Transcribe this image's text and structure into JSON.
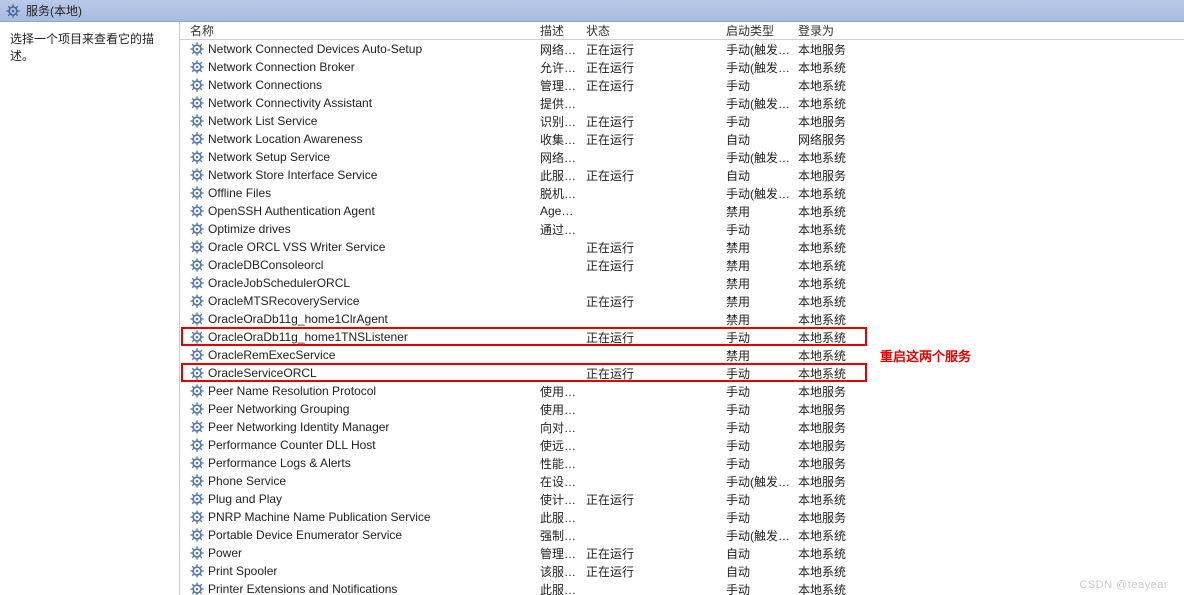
{
  "title": "服务(本地)",
  "side_hint": "选择一个项目来查看它的描述。",
  "columns": {
    "name": "名称",
    "desc": "描述",
    "status": "状态",
    "startup": "启动类型",
    "logon": "登录为"
  },
  "annotation": "重启这两个服务",
  "watermark": "CSDN @teayear",
  "rows": [
    {
      "name": "Network Connected Devices Auto-Setup",
      "desc": "网络…",
      "status": "正在运行",
      "startup": "手动(触发…",
      "logon": "本地服务"
    },
    {
      "name": "Network Connection Broker",
      "desc": "允许 …",
      "status": "正在运行",
      "startup": "手动(触发…",
      "logon": "本地系统"
    },
    {
      "name": "Network Connections",
      "desc": "管理\"…",
      "status": "正在运行",
      "startup": "手动",
      "logon": "本地系统"
    },
    {
      "name": "Network Connectivity Assistant",
      "desc": "提供 …",
      "status": "",
      "startup": "手动(触发…",
      "logon": "本地系统"
    },
    {
      "name": "Network List Service",
      "desc": "识别…",
      "status": "正在运行",
      "startup": "手动",
      "logon": "本地服务"
    },
    {
      "name": "Network Location Awareness",
      "desc": "收集…",
      "status": "正在运行",
      "startup": "自动",
      "logon": "网络服务"
    },
    {
      "name": "Network Setup Service",
      "desc": "网络…",
      "status": "",
      "startup": "手动(触发…",
      "logon": "本地系统"
    },
    {
      "name": "Network Store Interface Service",
      "desc": "此服…",
      "status": "正在运行",
      "startup": "自动",
      "logon": "本地服务"
    },
    {
      "name": "Offline Files",
      "desc": "脱机…",
      "status": "",
      "startup": "手动(触发…",
      "logon": "本地系统"
    },
    {
      "name": "OpenSSH Authentication Agent",
      "desc": "Age…",
      "status": "",
      "startup": "禁用",
      "logon": "本地系统"
    },
    {
      "name": "Optimize drives",
      "desc": "通过…",
      "status": "",
      "startup": "手动",
      "logon": "本地系统"
    },
    {
      "name": "Oracle ORCL VSS Writer Service",
      "desc": "",
      "status": "正在运行",
      "startup": "禁用",
      "logon": "本地系统"
    },
    {
      "name": "OracleDBConsoleorcl",
      "desc": "",
      "status": "正在运行",
      "startup": "禁用",
      "logon": "本地系统"
    },
    {
      "name": "OracleJobSchedulerORCL",
      "desc": "",
      "status": "",
      "startup": "禁用",
      "logon": "本地系统"
    },
    {
      "name": "OracleMTSRecoveryService",
      "desc": "",
      "status": "正在运行",
      "startup": "禁用",
      "logon": "本地系统"
    },
    {
      "name": "OracleOraDb11g_home1ClrAgent",
      "desc": "",
      "status": "",
      "startup": "禁用",
      "logon": "本地系统"
    },
    {
      "name": "OracleOraDb11g_home1TNSListener",
      "desc": "",
      "status": "正在运行",
      "startup": "手动",
      "logon": "本地系统"
    },
    {
      "name": "OracleRemExecService",
      "desc": "",
      "status": "",
      "startup": "禁用",
      "logon": "本地系统"
    },
    {
      "name": "OracleServiceORCL",
      "desc": "",
      "status": "正在运行",
      "startup": "手动",
      "logon": "本地系统"
    },
    {
      "name": "Peer Name Resolution Protocol",
      "desc": "使用…",
      "status": "",
      "startup": "手动",
      "logon": "本地服务"
    },
    {
      "name": "Peer Networking Grouping",
      "desc": "使用…",
      "status": "",
      "startup": "手动",
      "logon": "本地服务"
    },
    {
      "name": "Peer Networking Identity Manager",
      "desc": "向对…",
      "status": "",
      "startup": "手动",
      "logon": "本地服务"
    },
    {
      "name": "Performance Counter DLL Host",
      "desc": "使远…",
      "status": "",
      "startup": "手动",
      "logon": "本地服务"
    },
    {
      "name": "Performance Logs & Alerts",
      "desc": "性能…",
      "status": "",
      "startup": "手动",
      "logon": "本地服务"
    },
    {
      "name": "Phone Service",
      "desc": "在设…",
      "status": "",
      "startup": "手动(触发…",
      "logon": "本地服务"
    },
    {
      "name": "Plug and Play",
      "desc": "使计…",
      "status": "正在运行",
      "startup": "手动",
      "logon": "本地系统"
    },
    {
      "name": "PNRP Machine Name Publication Service",
      "desc": "此服…",
      "status": "",
      "startup": "手动",
      "logon": "本地服务"
    },
    {
      "name": "Portable Device Enumerator Service",
      "desc": "强制…",
      "status": "",
      "startup": "手动(触发…",
      "logon": "本地系统"
    },
    {
      "name": "Power",
      "desc": "管理…",
      "status": "正在运行",
      "startup": "自动",
      "logon": "本地系统"
    },
    {
      "name": "Print Spooler",
      "desc": "该服…",
      "status": "正在运行",
      "startup": "自动",
      "logon": "本地系统"
    },
    {
      "name": "Printer Extensions and Notifications",
      "desc": "此服…",
      "status": "",
      "startup": "手动",
      "logon": "本地系统"
    }
  ],
  "highlight": {
    "box1_row": 16,
    "box2_row": 18
  }
}
